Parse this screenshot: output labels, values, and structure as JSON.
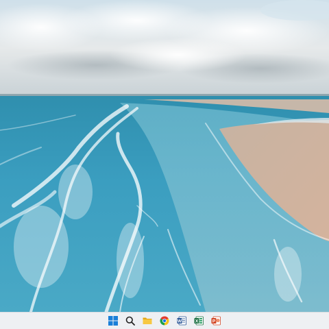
{
  "desktop": {
    "wallpaper_name": "beach-shoreline-wallpaper"
  },
  "taskbar": {
    "background": "#eef0f3",
    "icons": [
      {
        "name": "start-icon",
        "color": "#1a7fd8"
      },
      {
        "name": "search-icon",
        "color": "#222222"
      },
      {
        "name": "file-explorer-icon",
        "color": "#f2b92b"
      },
      {
        "name": "chrome-icon",
        "color": "#e33b2e"
      },
      {
        "name": "word-icon",
        "color": "#2b5797",
        "glyph": "W"
      },
      {
        "name": "excel-icon",
        "color": "#1e7145",
        "glyph": "X"
      },
      {
        "name": "powerpoint-icon",
        "color": "#d24726",
        "glyph": "P"
      }
    ]
  }
}
